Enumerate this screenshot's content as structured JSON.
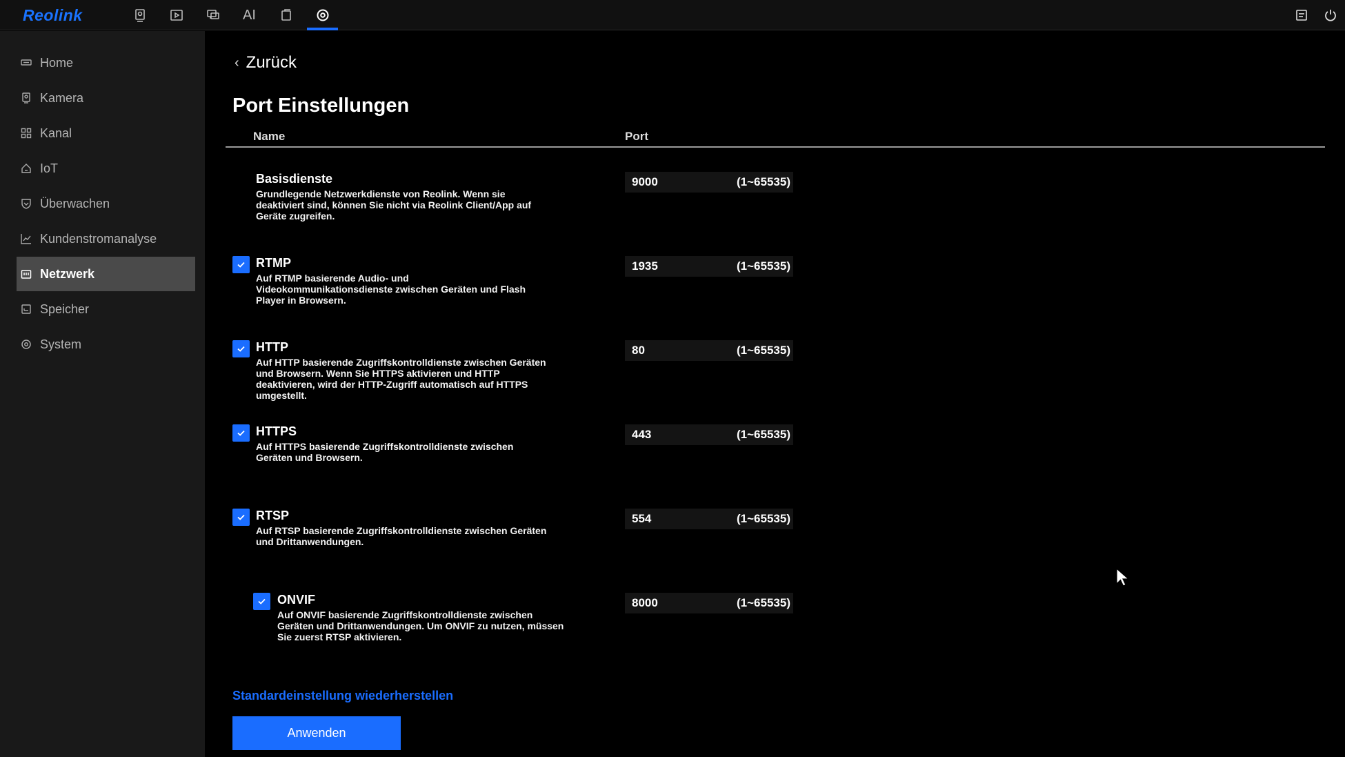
{
  "app": {
    "logo": "Reolink"
  },
  "topnav": {
    "ai_label": "AI"
  },
  "sidebar": {
    "items": [
      {
        "label": "Home",
        "icon": "home-icon"
      },
      {
        "label": "Kamera",
        "icon": "camera-icon"
      },
      {
        "label": "Kanal",
        "icon": "grid-icon"
      },
      {
        "label": "IoT",
        "icon": "iot-house-icon"
      },
      {
        "label": "Überwachen",
        "icon": "shield-icon"
      },
      {
        "label": "Kundenstromanalyse",
        "icon": "chart-icon"
      },
      {
        "label": "Netzwerk",
        "icon": "network-icon",
        "active": true
      },
      {
        "label": "Speicher",
        "icon": "storage-icon"
      },
      {
        "label": "System",
        "icon": "gear-icon"
      }
    ]
  },
  "page": {
    "back_label": "Zurück",
    "title": "Port Einstellungen",
    "col_name": "Name",
    "col_port": "Port"
  },
  "ports": [
    {
      "name": "Basisdienste",
      "desc": "Grundlegende Netzwerkdienste von Reolink. Wenn sie deaktiviert sind, können Sie nicht via Reolink Client/App auf Geräte zugreifen.",
      "port": "9000",
      "range": "(1~65535)",
      "checkbox": false
    },
    {
      "name": "RTMP",
      "desc": "Auf RTMP basierende Audio- und Videokommunikationsdienste zwischen Geräten und Flash Player in Browsern.",
      "port": "1935",
      "range": "(1~65535)",
      "checkbox": true,
      "checked": true
    },
    {
      "name": "HTTP",
      "desc": "Auf HTTP basierende Zugriffskontrolldienste zwischen Geräten und Browsern. Wenn Sie HTTPS aktivieren und HTTP deaktivieren, wird der HTTP-Zugriff automatisch auf HTTPS umgestellt.",
      "port": "80",
      "range": "(1~65535)",
      "checkbox": true,
      "checked": true
    },
    {
      "name": "HTTPS",
      "desc": "Auf HTTPS basierende Zugriffskontrolldienste zwischen Geräten und Browsern.",
      "port": "443",
      "range": "(1~65535)",
      "checkbox": true,
      "checked": true
    },
    {
      "name": "RTSP",
      "desc": "Auf RTSP basierende Zugriffskontrolldienste zwischen Geräten und Drittanwendungen.",
      "port": "554",
      "range": "(1~65535)",
      "checkbox": true,
      "checked": true
    },
    {
      "name": "ONVIF",
      "desc": "Auf ONVIF basierende Zugriffskontrolldienste zwischen Geräten und Drittanwendungen. Um ONVIF zu nutzen, müssen Sie zuerst RTSP aktivieren.",
      "port": "8000",
      "range": "(1~65535)",
      "checkbox": true,
      "checked": true,
      "indented": true
    }
  ],
  "actions": {
    "restore_label": "Standardeinstellung wiederherstellen",
    "apply_label": "Anwenden"
  },
  "colors": {
    "accent": "#1a6dff",
    "background": "#000000",
    "sidebar": "#191919"
  }
}
